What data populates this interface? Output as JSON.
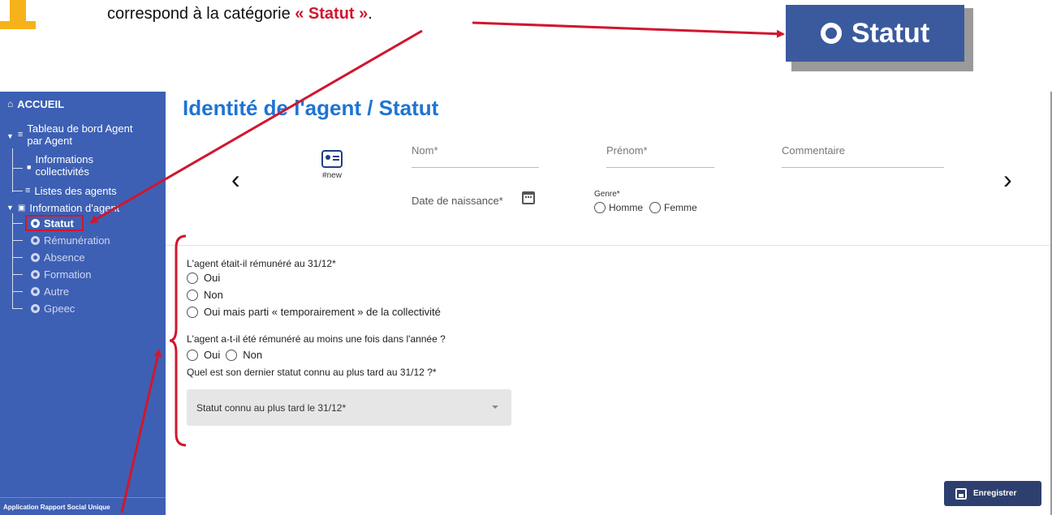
{
  "instruction": {
    "prefix": "correspond à la catégorie ",
    "highlight": "« Statut »",
    "suffix": "."
  },
  "zoom_label": "Statut",
  "sidebar": {
    "home": "ACCUEIL",
    "dashboard_line1": "Tableau de bord Agent",
    "dashboard_line2": "par Agent",
    "info_collect_line1": "Informations",
    "info_collect_line2": "collectivités",
    "agents_list": "Listes des agents",
    "agent_info": "Information d'agent",
    "items": [
      {
        "label": "Statut",
        "active": true
      },
      {
        "label": "Rémunération",
        "active": false
      },
      {
        "label": "Absence",
        "active": false
      },
      {
        "label": "Formation",
        "active": false
      },
      {
        "label": "Autre",
        "active": false
      },
      {
        "label": "Gpeec",
        "active": false
      }
    ],
    "footer": "Application Rapport Social Unique"
  },
  "main": {
    "title": "Identité de l'agent / Statut",
    "agent_id": "#new",
    "fields": {
      "nom": "Nom*",
      "prenom": "Prénom*",
      "commentaire": "Commentaire",
      "dob": "Date de naissance*",
      "genre": "Genre*",
      "genre_options": [
        "Homme",
        "Femme"
      ]
    },
    "questions": {
      "q1": "L'agent était-il rémunéré au 31/12*",
      "q1_options": [
        "Oui",
        "Non",
        "Oui mais parti « temporairement » de la collectivité"
      ],
      "q2": "L'agent a-t-il été rémunéré au moins une fois dans l'année ?",
      "q2_options": [
        "Oui",
        "Non"
      ],
      "q3": "Quel est son dernier statut connu au plus tard au 31/12 ?*",
      "q3_select": "Statut connu au plus tard le 31/12*"
    },
    "save_label": "Enregistrer"
  },
  "colors": {
    "sidebar": "#3d60b4",
    "title": "#1f74d3",
    "annotation": "#d1162f",
    "step_badge": "#f6b21b",
    "save_button": "#2d3f6e"
  }
}
